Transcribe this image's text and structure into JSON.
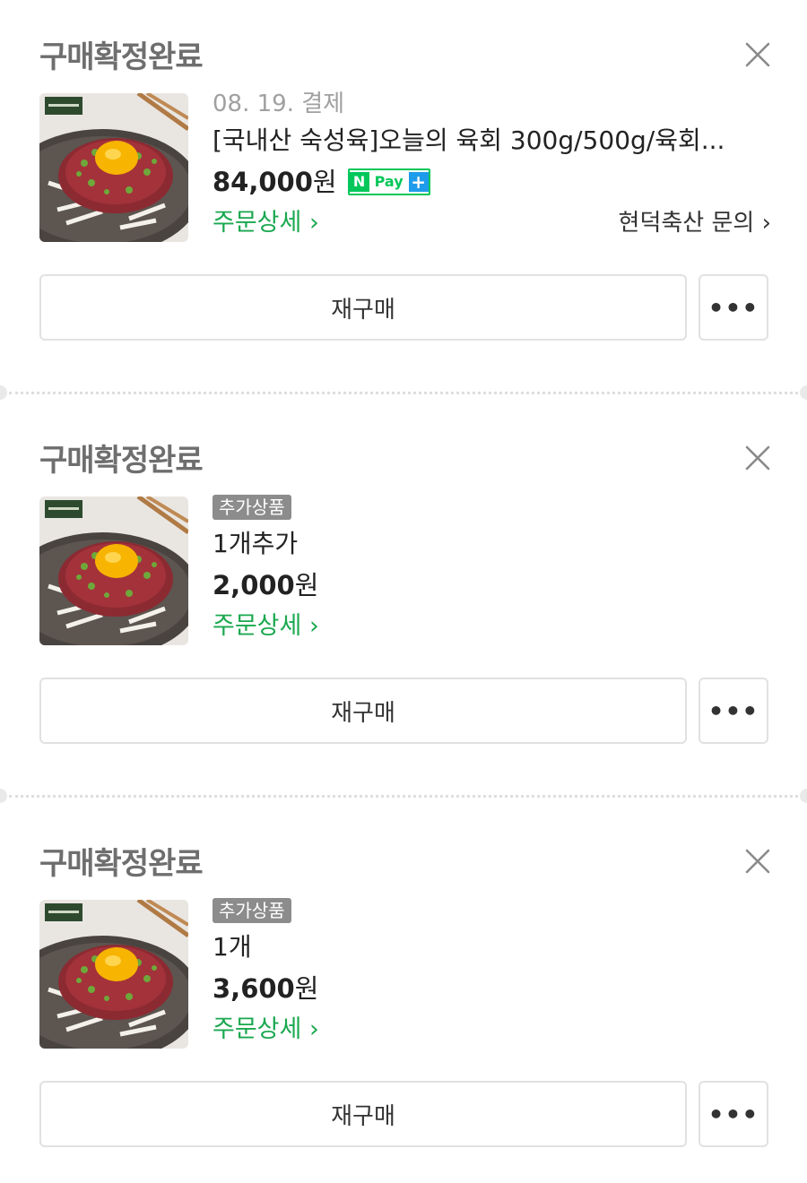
{
  "orders": [
    {
      "status": "구매확정완료",
      "date": "08. 19. 결제",
      "tag": "",
      "name": "[국내산 숙성육]오늘의 육회 300g/500g/육회...",
      "price": "84,000",
      "won": "원",
      "npay": {
        "n": "N",
        "pay": "Pay",
        "plus": "+"
      },
      "detail_link": "주문상세 ›",
      "seller_link": "현덕축산 문의 ›",
      "rebuy_label": "재구매",
      "more_label": "•••"
    },
    {
      "status": "구매확정완료",
      "date": "",
      "tag": "추가상품",
      "name": "1개추가",
      "price": "2,000",
      "won": "원",
      "detail_link": "주문상세 ›",
      "seller_link": "",
      "rebuy_label": "재구매",
      "more_label": "•••"
    },
    {
      "status": "구매확정완료",
      "date": "",
      "tag": "추가상품",
      "name": "1개",
      "price": "3,600",
      "won": "원",
      "detail_link": "주문상세 ›",
      "seller_link": "",
      "rebuy_label": "재구매",
      "more_label": "•••"
    }
  ],
  "colors": {
    "status_gray": "#6e6e6e",
    "link_green": "#1aa84f",
    "npay_green": "#03c75a",
    "npay_blue": "#1e9bea",
    "tag_gray": "#8c8c8c"
  },
  "icons": [
    "close-icon",
    "more-icon",
    "npay-logo"
  ]
}
